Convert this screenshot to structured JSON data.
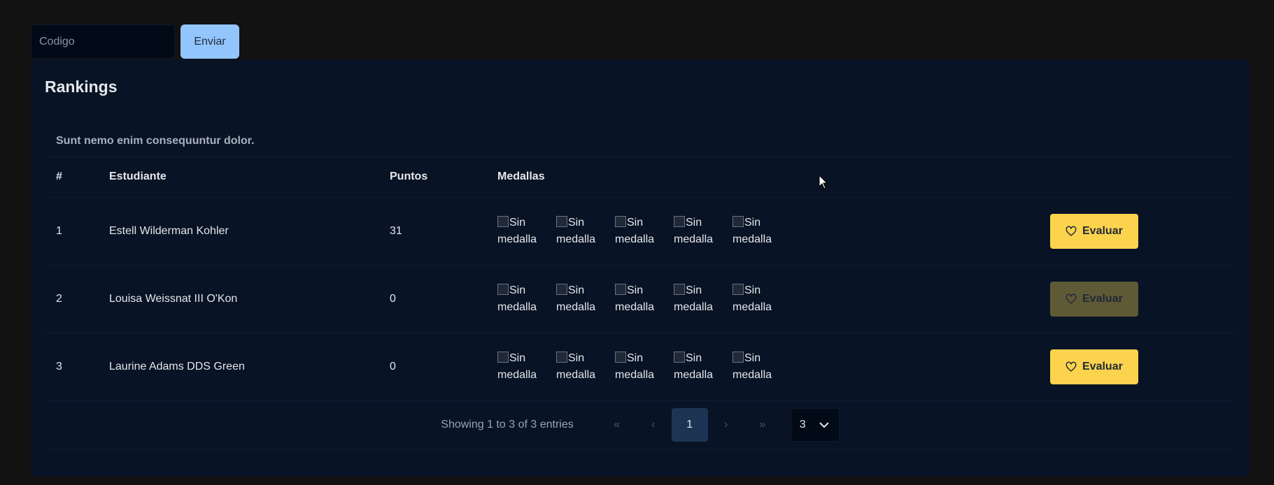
{
  "form": {
    "code_placeholder": "Codigo",
    "send_label": "Enviar"
  },
  "panel": {
    "title": "Rankings",
    "caption": "Sunt nemo enim consequuntur dolor."
  },
  "table": {
    "headers": {
      "num": "#",
      "student": "Estudiante",
      "points": "Puntos",
      "medals": "Medallas"
    },
    "rows": [
      {
        "num": "1",
        "student": "Estell Wilderman Kohler",
        "points": "31",
        "medal_alt_line1": "Sin",
        "medal_alt_line2": "medalla",
        "action": "Evaluar",
        "action_enabled": true
      },
      {
        "num": "2",
        "student": "Louisa Weissnat III O'Kon",
        "points": "0",
        "medal_alt_line1": "Sin",
        "medal_alt_line2": "medalla",
        "action": "Evaluar",
        "action_enabled": false
      },
      {
        "num": "3",
        "student": "Laurine Adams DDS Green",
        "points": "0",
        "medal_alt_line1": "Sin",
        "medal_alt_line2": "medalla",
        "action": "Evaluar",
        "action_enabled": true
      }
    ]
  },
  "pagination": {
    "info": "Showing 1 to 3 of 3 entries",
    "first": "«",
    "prev": "‹",
    "current": "1",
    "next": "›",
    "last": "»",
    "per_page": "3"
  },
  "colors": {
    "background": "#121212",
    "panel": "#081325",
    "accent_button": "#fcd34d",
    "send_button": "#93c5fd"
  }
}
